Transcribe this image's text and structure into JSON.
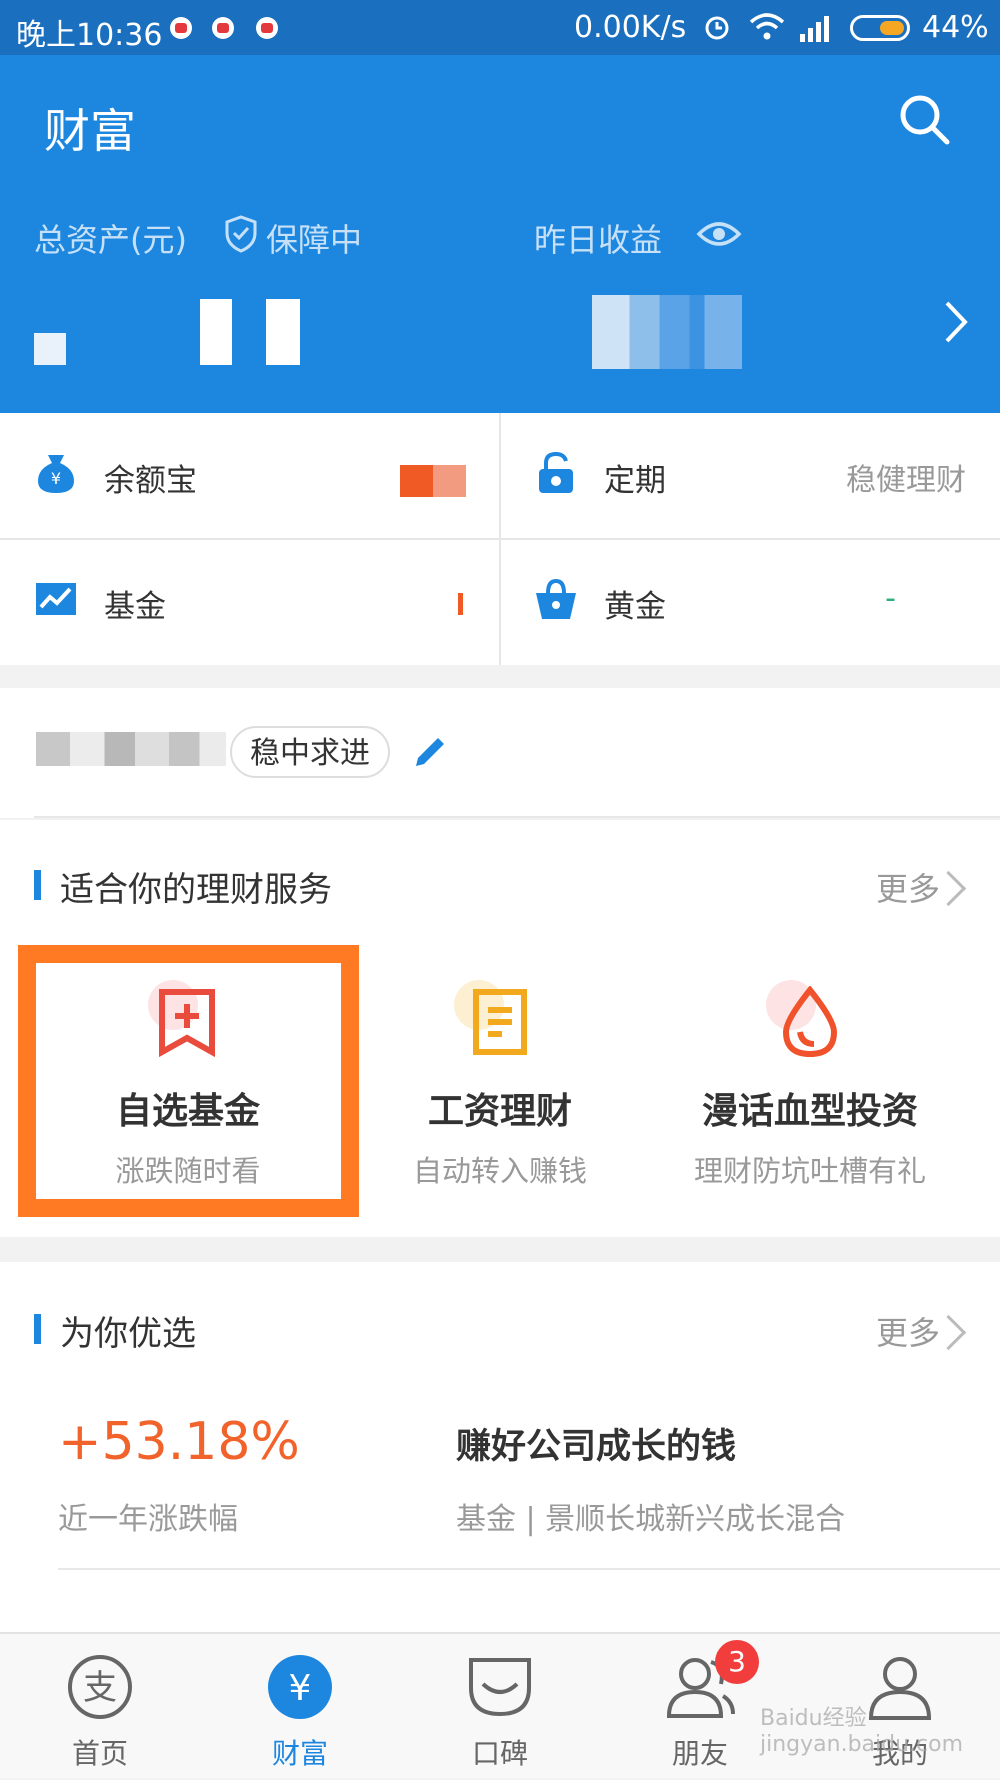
{
  "status_bar": {
    "time": "晚上10:36",
    "speed": "0.00K/s",
    "battery": "44%"
  },
  "header": {
    "title": "财富",
    "total_assets_label": "总资产(元)",
    "protected_label": "保障中",
    "yesterday_label": "昨日收益"
  },
  "assets": [
    {
      "name": "余额宝",
      "right": ""
    },
    {
      "name": "定期",
      "right": "稳健理财"
    },
    {
      "name": "基金",
      "right": ""
    },
    {
      "name": "黄金",
      "right": "-"
    }
  ],
  "tag": {
    "label": "稳中求进"
  },
  "services": {
    "title": "适合你的理财服务",
    "more": "更多",
    "items": [
      {
        "title": "自选基金",
        "sub": "涨跌随时看"
      },
      {
        "title": "工资理财",
        "sub": "自动转入赚钱"
      },
      {
        "title": "漫话血型投资",
        "sub": "理财防坑吐槽有礼"
      }
    ]
  },
  "recommend": {
    "title": "为你优选",
    "more": "更多",
    "item": {
      "rate": "+53.18%",
      "rate_label": "近一年涨跌幅",
      "name": "赚好公司成长的钱",
      "sub": "基金 | 景顺长城新兴成长混合"
    }
  },
  "tabbar": {
    "tabs": [
      {
        "label": "首页"
      },
      {
        "label": "财富"
      },
      {
        "label": "口碑"
      },
      {
        "label": "朋友",
        "badge": "3"
      },
      {
        "label": "我的"
      }
    ]
  },
  "watermark": "Baidu经验 jingyan.baidu.com",
  "colors": {
    "brand_blue": "#1d87e0",
    "orange_highlight": "#ff7a23",
    "rate_red": "#f2622b"
  }
}
